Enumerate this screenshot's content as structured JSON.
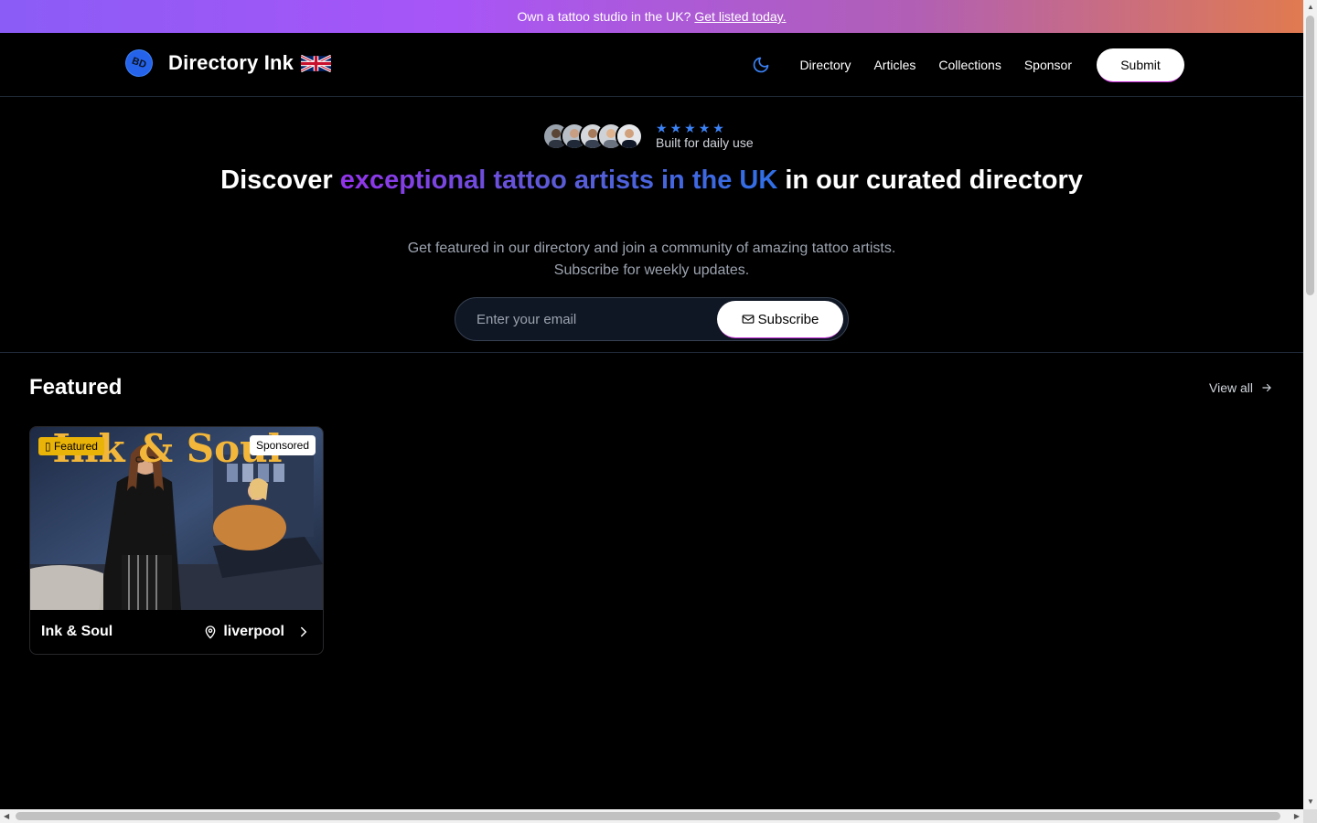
{
  "banner": {
    "text": "Own a tattoo studio in the UK?",
    "link": "Get listed today."
  },
  "header": {
    "logo_text": "BD",
    "brand": "Directory Ink",
    "flag_icon": "uk-flag-icon",
    "theme_icon": "moon-icon",
    "nav": [
      "Directory",
      "Articles",
      "Collections",
      "Sponsor"
    ],
    "submit": "Submit"
  },
  "hero": {
    "rating_stars": 5,
    "proof_label": "Built for daily use",
    "title_start": "Discover ",
    "title_highlight": "exceptional tattoo artists in the UK",
    "title_end": " in our curated directory",
    "subtitle": "Get featured in our directory and join a community of amazing tattoo artists. Subscribe for weekly updates.",
    "email_placeholder": "Enter your email",
    "subscribe_label": "Subscribe"
  },
  "featured": {
    "title": "Featured",
    "view_all": "View all",
    "cards": [
      {
        "image_text": "Ink & Soul",
        "badge_featured": "Featured",
        "badge_sponsored": "Sponsored",
        "name": "Ink & Soul",
        "location": "liverpool"
      }
    ]
  },
  "colors": {
    "accent_blue": "#3b82f6",
    "accent_purple": "#9333ea",
    "badge_yellow": "#eab308"
  }
}
